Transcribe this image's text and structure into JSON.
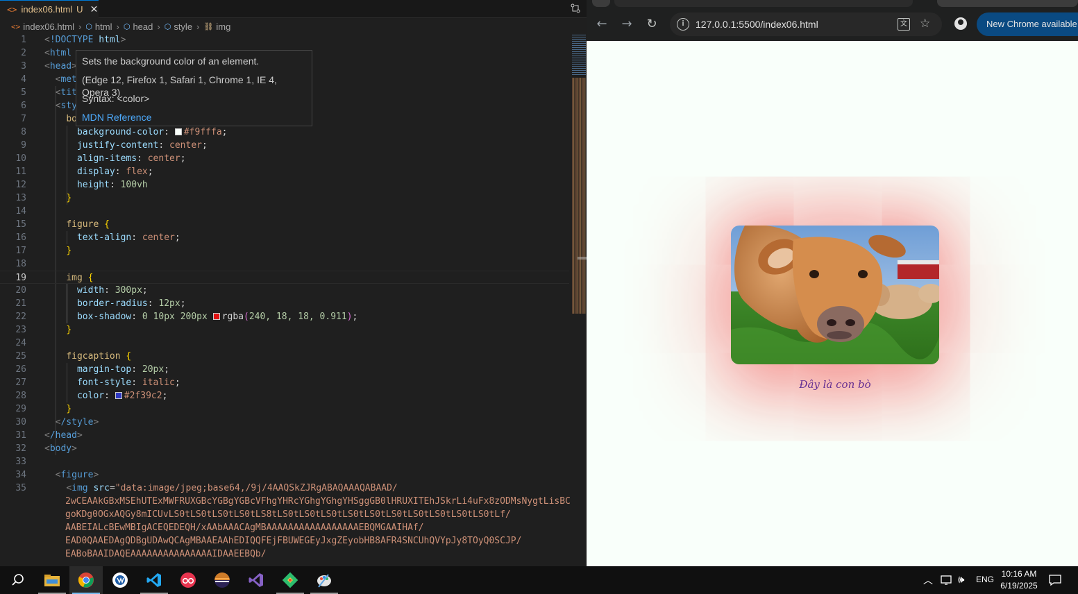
{
  "editor": {
    "tab": {
      "filename": "index06.html",
      "status": "U",
      "close": "✕"
    },
    "breadcrumb": [
      "index06.html",
      "html",
      "head",
      "style",
      "img"
    ],
    "lines": [
      {
        "n": "1"
      },
      {
        "n": "2"
      },
      {
        "n": "3"
      },
      {
        "n": "4"
      },
      {
        "n": "5"
      },
      {
        "n": "6"
      },
      {
        "n": "7"
      },
      {
        "n": "8"
      },
      {
        "n": "9"
      },
      {
        "n": "10"
      },
      {
        "n": "11"
      },
      {
        "n": "12"
      },
      {
        "n": "13"
      },
      {
        "n": "14"
      },
      {
        "n": "15"
      },
      {
        "n": "16"
      },
      {
        "n": "17"
      },
      {
        "n": "18"
      },
      {
        "n": "19"
      },
      {
        "n": "20"
      },
      {
        "n": "21"
      },
      {
        "n": "22"
      },
      {
        "n": "23"
      },
      {
        "n": "24"
      },
      {
        "n": "25"
      },
      {
        "n": "26"
      },
      {
        "n": "27"
      },
      {
        "n": "28"
      },
      {
        "n": "29"
      },
      {
        "n": "30"
      },
      {
        "n": "31"
      },
      {
        "n": "32"
      },
      {
        "n": "33"
      },
      {
        "n": "34"
      },
      {
        "n": "35"
      }
    ],
    "code": {
      "l1": "!DOCTYPE",
      "l1b": "html",
      "l2": "html",
      "l3": "head",
      "l4": "met",
      "l5": "tit",
      "l6": "sty",
      "l7": "bo",
      "l8_prop": "background-color",
      "l8_val": "#f9fffa",
      "l9_prop": "justify-content",
      "l9_val": "center",
      "l10_prop": "align-items",
      "l10_val": "center",
      "l11_prop": "display",
      "l11_val": "flex",
      "l12_prop": "height",
      "l12_val": "100vh",
      "l15_sel": "figure",
      "l16_prop": "text-align",
      "l16_val": "center",
      "l19_sel": "img",
      "l20_prop": "width",
      "l20_val": "300px",
      "l21_prop": "border-radius",
      "l21_val": "12px",
      "l22_prop": "box-shadow",
      "l22_val1": "0",
      "l22_val2": "10px",
      "l22_val3": "200px",
      "l22_val4": "rgba",
      "l22_args": "240, 18, 18, 0.911",
      "l25_sel": "figcaption",
      "l26_prop": "margin-top",
      "l26_val": "20px",
      "l27_prop": "font-style",
      "l27_val": "italic",
      "l28_prop": "color",
      "l28_val": "#2f39c2",
      "l30": "/style",
      "l31": "/head",
      "l32": "body",
      "l34": "figure",
      "l35_tag": "img",
      "l35_attr": "src",
      "l35_s1": "\"data:image/jpeg;base64,/9j/4AAQSkZJRgABAQAAAQABAAD/",
      "l35_s2": "2wCEAAkGBxMSEhUTExMWFRUXGBcYGBgYGBcVFhgYHRcYGhgYGhgYHSggGB0lHRUXITEhJSkrLi4uFx8zODMsNygtLisBC",
      "l35_s3": "goKDg0OGxAQGy8mICUvLS0tLS0tLS0tLS0tLS8tLS0tLS0tLS0tLS0tLS0tLS0tLS0tLS0tLS0tLS0tLf/",
      "l35_s4": "AABEIALcBEwMBIgACEQEDEQH/xAAbAAACAgMBAAAAAAAAAAAAAAAAAEBQMGAAIHAf/",
      "l35_s5": "EAD0QAAEDAgQDBgUDAwQCAgMBAAEAAhEDIQQFEjFBUWEGEyJxgZEyobHB8AFR4SNCUhQVYpJy8TOyQ0SCJP/",
      "l35_s6": "EABoBAAIDAQEAAAAAAAAAAAAAAAIDAAEEBQb/"
    },
    "hover": {
      "line1": "Sets the background color of an element.",
      "line2": "(Edge 12, Firefox 1, Safari 1, Chrome 1, IE 4, Opera 3)",
      "line3": "Syntax: <color>",
      "link": "MDN Reference"
    }
  },
  "browser": {
    "url": "127.0.0.1:5500/index06.html",
    "update_label": "New Chrome available",
    "page": {
      "background": "#f9fffa",
      "caption": "Đây là con bò",
      "caption_color": "#2f39c2",
      "shadow_color": "rgba(240, 18, 18, 0.911)"
    }
  },
  "taskbar": {
    "apps": [
      "start-search-icon",
      "file-explorer-icon",
      "chrome-icon",
      "paint-icon",
      "vscode-icon",
      "app-icon",
      "eclipse-icon",
      "visual-studio-icon",
      "git-icon",
      "paint-brush-icon"
    ],
    "lang": "ENG",
    "time": "10:16 AM",
    "date": "6/19/2025"
  }
}
